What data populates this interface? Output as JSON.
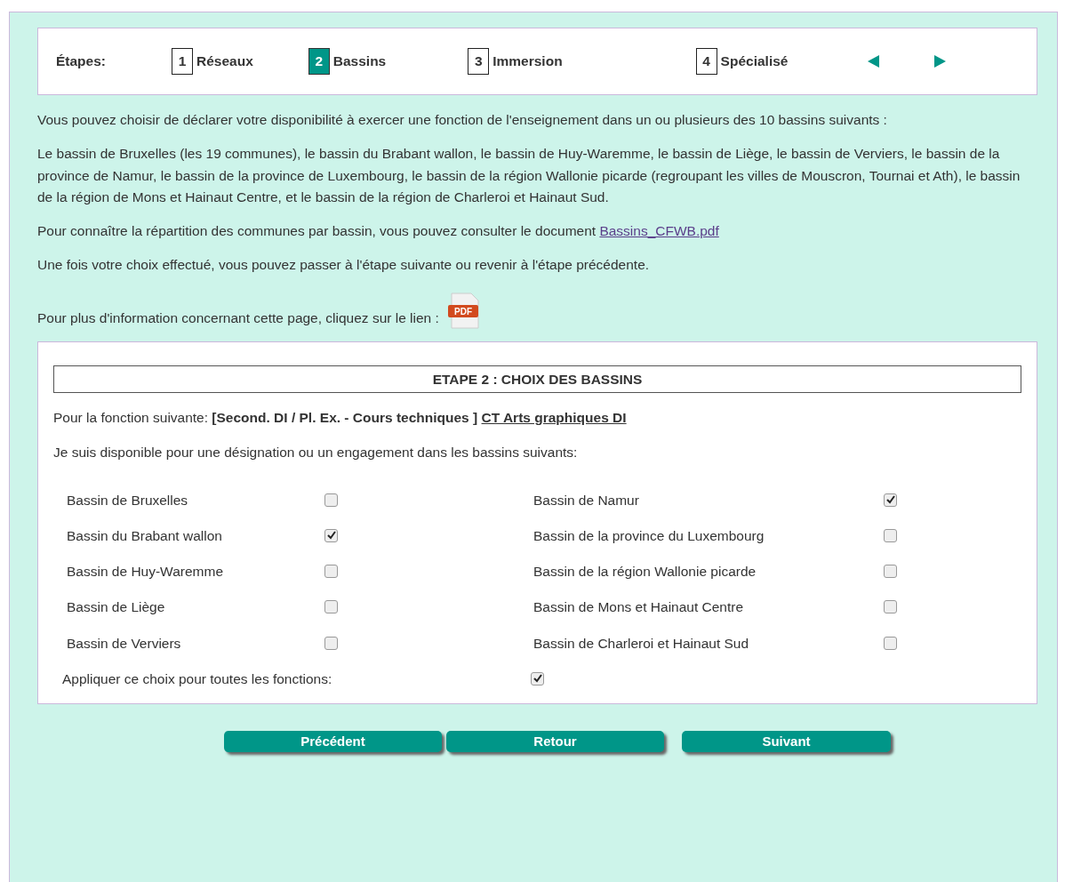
{
  "steps_label": "Étapes:",
  "steps": [
    {
      "number": "1",
      "label": "Réseaux",
      "selected": false
    },
    {
      "number": "2",
      "label": "Bassins",
      "selected": true
    },
    {
      "number": "3",
      "label": "Immersion",
      "selected": false
    },
    {
      "number": "4",
      "label": "Spécialisé",
      "selected": false
    }
  ],
  "intro": [
    "Vous pouvez choisir de déclarer votre disponibilité à exercer une fonction de l'enseignement dans un ou plusieurs des 10 bassins suivants :",
    "Le bassin de Bruxelles (les 19 communes), le bassin du Brabant wallon, le bassin de Huy-Waremme, le bassin de Liège, le bassin de Verviers, le bassin de la province de Namur, le bassin de la province de Luxembourg, le bassin de la région Wallonie picarde (regroupant les villes de Mouscron, Tournai et Ath), le bassin de la région de Mons et Hainaut Centre, et le bassin de la région de Charleroi et Hainaut Sud."
  ],
  "document_text": "Pour connaître la répartition des communes par bassin, vous pouvez consulter le document",
  "document_link": "Bassins_CFWB.pdf",
  "next_step_text": "Une fois votre choix effectué, vous pouvez passer à l'étape suivante ou revenir à l'étape précédente.",
  "info_text": "Pour plus d'information concernant cette page, cliquez sur le lien :",
  "pdf_icon_label": "PDF",
  "section_title": "ETAPE 2 : CHOIX DES BASSINS",
  "function_prefix": "Pour la fonction suivante:",
  "function_category": "[Second. DI / Pl. Ex. - Cours techniques ]",
  "function_link": "CT Arts graphiques DI",
  "availability_text": "Je suis disponible pour une désignation ou un engagement dans les bassins suivants:",
  "basins_left": [
    {
      "label": "Bassin de Bruxelles",
      "checked": false
    },
    {
      "label": "Bassin du Brabant wallon",
      "checked": true
    },
    {
      "label": "Bassin de Huy-Waremme",
      "checked": false
    },
    {
      "label": "Bassin de Liège",
      "checked": false
    },
    {
      "label": "Bassin de Verviers",
      "checked": false
    }
  ],
  "basins_right": [
    {
      "label": "Bassin de Namur",
      "checked": true
    },
    {
      "label": "Bassin de la province du Luxembourg",
      "checked": false
    },
    {
      "label": "Bassin de la région Wallonie picarde",
      "checked": false
    },
    {
      "label": "Bassin de Mons et Hainaut Centre",
      "checked": false
    },
    {
      "label": "Bassin de Charleroi et Hainaut Sud",
      "checked": false
    }
  ],
  "apply_all": {
    "label": "Appliquer ce choix pour toutes les fonctions:",
    "checked": true
  },
  "buttons": [
    "Précédent",
    "Retour",
    "Suivant"
  ]
}
